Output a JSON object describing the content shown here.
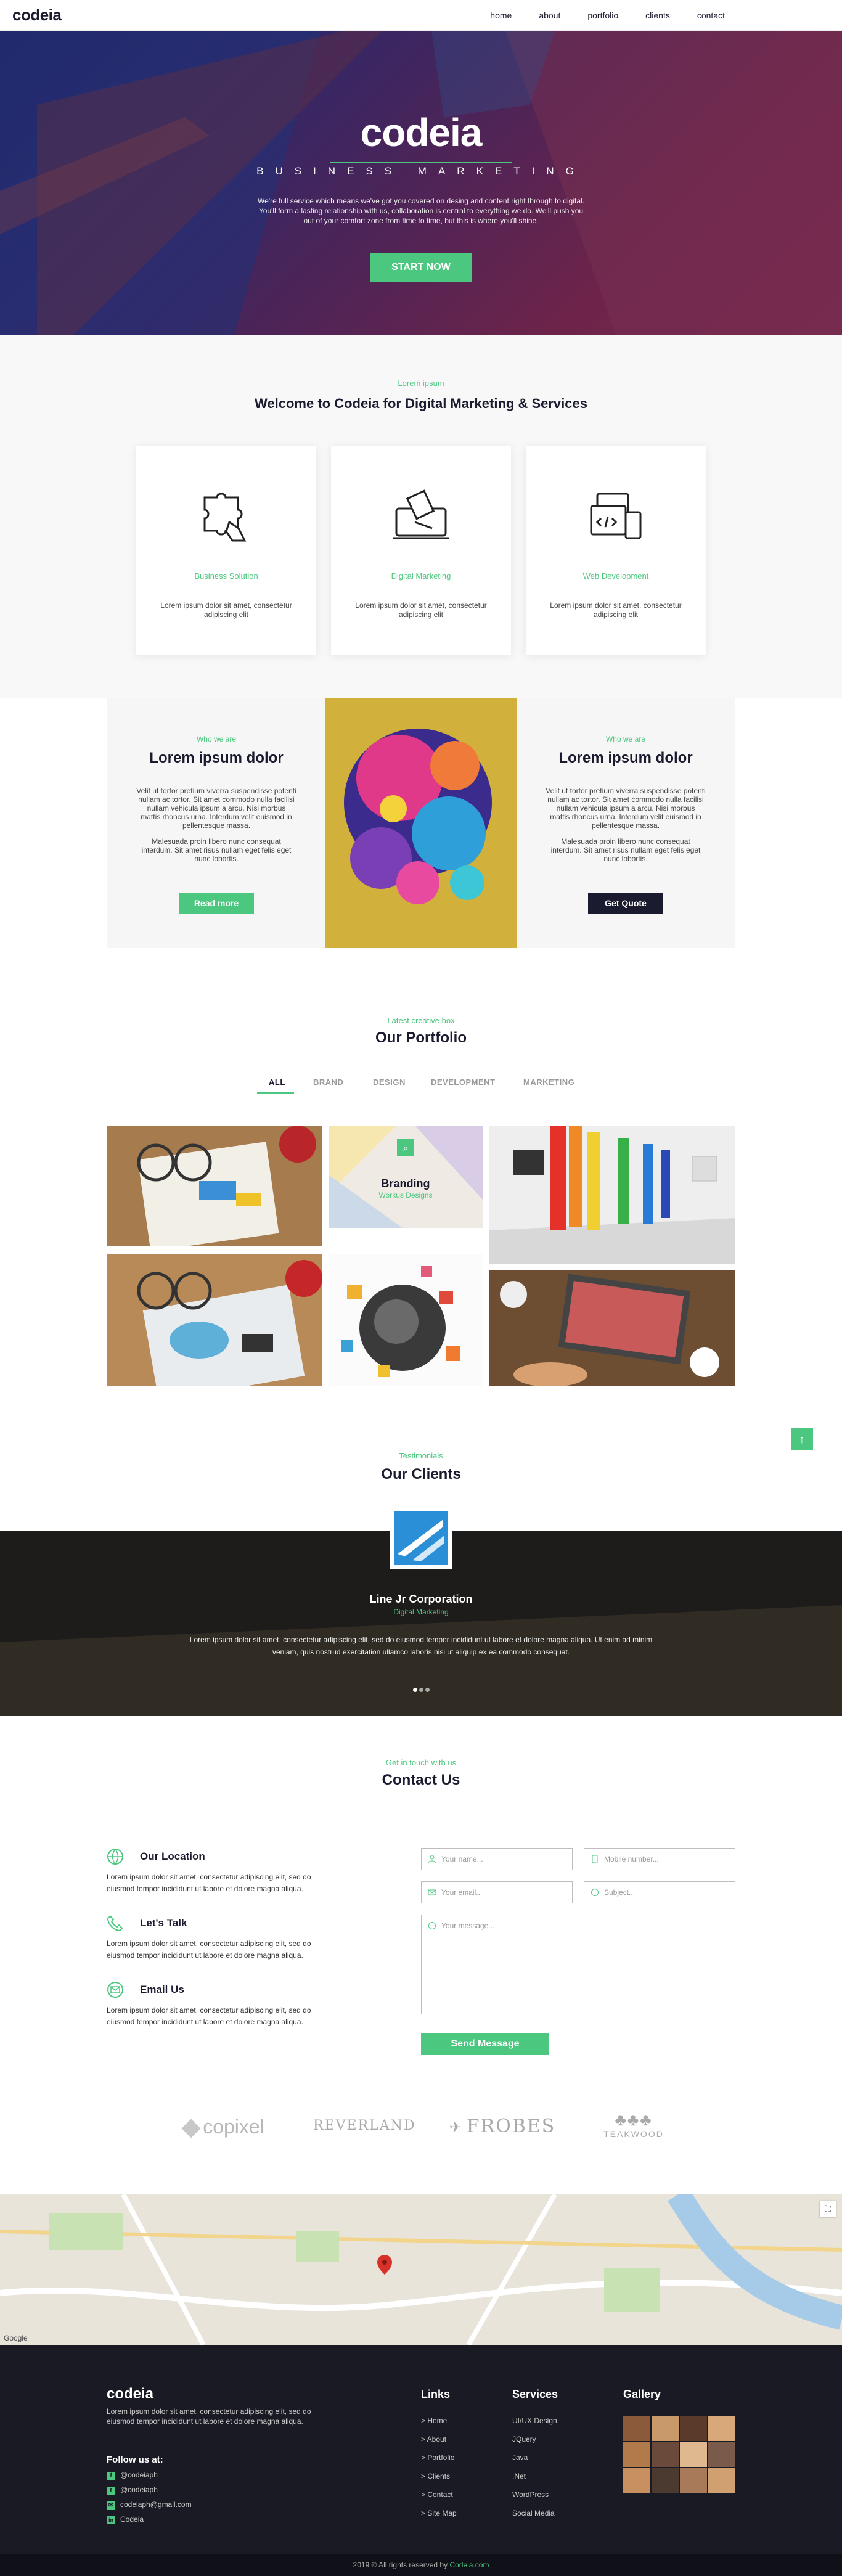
{
  "header": {
    "logo": "codeia",
    "nav": [
      "home",
      "about",
      "portfolio",
      "clients",
      "contact"
    ]
  },
  "hero": {
    "title": "codeia",
    "subtitle": "BUSINESS MARKETING",
    "text": "We're full service which means we've got you covered on desing and content right through to digital. You'll form a lasting relationship with us, collaboration is central to everything we do. We'll push you out of your comfort zone from time to time, but this is where you'll shine.",
    "button": "START NOW"
  },
  "welcome": {
    "kicker": "Lorem ipsum",
    "heading": "Welcome to Codeia for Digital Marketing & Services",
    "cards": [
      {
        "title": "Business Solution",
        "text": "Lorem ipsum dolor sit amet, consectetur adipiscing elit",
        "icon": "puzzle-icon"
      },
      {
        "title": "Digital Marketing",
        "text": "Lorem ipsum dolor sit amet, consectetur adipiscing elit",
        "icon": "laptop-marketing-icon"
      },
      {
        "title": "Web Development",
        "text": "Lorem ipsum dolor sit amet, consectetur adipiscing elit",
        "icon": "code-window-icon"
      }
    ]
  },
  "who": {
    "left": {
      "kicker": "Who we are",
      "heading": "Lorem ipsum dolor",
      "p1": "Velit ut tortor pretium viverra suspendisse potenti nullam ac tortor. Sit amet commodo nulla facilisi nullam vehicula ipsum a arcu. Nisi morbus mattis rhoncus urna. Interdum velit euismod in pellentesque massa.",
      "p2": "Malesuada proin libero nunc consequat interdum. Sit amet risus nullam eget felis eget nunc lobortis.",
      "button": "Read more"
    },
    "right": {
      "kicker": "Who we are",
      "heading": "Lorem ipsum dolor",
      "p1": "Velit ut tortor pretium viverra suspendisse potenti nullam ac tortor. Sit amet commodo nulla facilisi nullam vehicula ipsum a arcu. Nisi morbus mattis rhoncus urna. Interdum velit euismod in pellentesque massa.",
      "p2": "Malesuada proin libero nunc consequat interdum. Sit amet risus nullam eget felis eget nunc lobortis.",
      "button": "Get Quote"
    }
  },
  "portfolio": {
    "kicker": "Latest creative box",
    "heading": "Our Portfolio",
    "tabs": [
      "ALL",
      "BRAND",
      "DESIGN",
      "DEVELOPMENT",
      "MARKETING"
    ],
    "active_tab": "ALL",
    "overlay": {
      "title": "Branding",
      "subtitle": "Workus Designs"
    }
  },
  "testimonials": {
    "kicker": "Testimonials",
    "heading": "Our Clients",
    "name": "Line Jr Corporation",
    "role": "Digital Marketing",
    "quote": "Lorem ipsum dolor sit amet, consectetur adipiscing elit, sed do eiusmod tempor incididunt ut labore et dolore magna aliqua. Ut enim ad minim veniam, quis nostrud exercitation ullamco laboris nisi ut aliquip ex ea commodo consequat."
  },
  "contact": {
    "kicker": "Get in touch with us",
    "heading": "Contact Us",
    "items": [
      {
        "title": "Our Location",
        "text": "Lorem ipsum dolor sit amet, consectetur adipiscing elit, sed do eiusmod tempor incididunt ut labore et dolore magna aliqua.",
        "icon": "globe-icon"
      },
      {
        "title": "Let's Talk",
        "text": "Lorem ipsum dolor sit amet, consectetur adipiscing elit, sed do eiusmod tempor incididunt ut labore et dolore magna aliqua.",
        "icon": "phone-icon"
      },
      {
        "title": "Email Us",
        "text": "Lorem ipsum dolor sit amet, consectetur adipiscing elit, sed do eiusmod tempor incididunt ut labore et dolore magna aliqua.",
        "icon": "mail-icon"
      }
    ],
    "form": {
      "name": "Your name...",
      "mobile": "Mobile number...",
      "email": "Your email...",
      "subject": "Subject...",
      "message": "Your message...",
      "button": "Send Message"
    }
  },
  "brands": [
    "copixel",
    "REVERLAND",
    "FROBES",
    "TEAKWOOD"
  ],
  "map": {
    "label": "Google"
  },
  "footer": {
    "logo": "codeia",
    "about": "Lorem ipsum dolor sit amet, consectetur adipiscing elit, sed do eiusmod tempor incididunt ut labore et dolore magna aliqua.",
    "follow": "Follow us at:",
    "social": [
      "@codeiaph",
      "@codeiaph",
      "codeiaph@gmail.com",
      "Codeia"
    ],
    "links_title": "Links",
    "links": [
      "> Home",
      "> About",
      "> Portfolio",
      "> Clients",
      "> Contact",
      "> Site Map"
    ],
    "services_title": "Services",
    "services": [
      "UI/UX Design",
      "JQuery",
      "Java",
      ".Net",
      "WordPress",
      "Social Media"
    ],
    "gallery_title": "Gallery"
  },
  "copyright": {
    "text": "2019 © All rights reserved by ",
    "brand": "Codeia.com"
  },
  "colors": {
    "accent": "#4cc77f",
    "dark": "#1b1b2f",
    "footer": "#1a1a24"
  }
}
